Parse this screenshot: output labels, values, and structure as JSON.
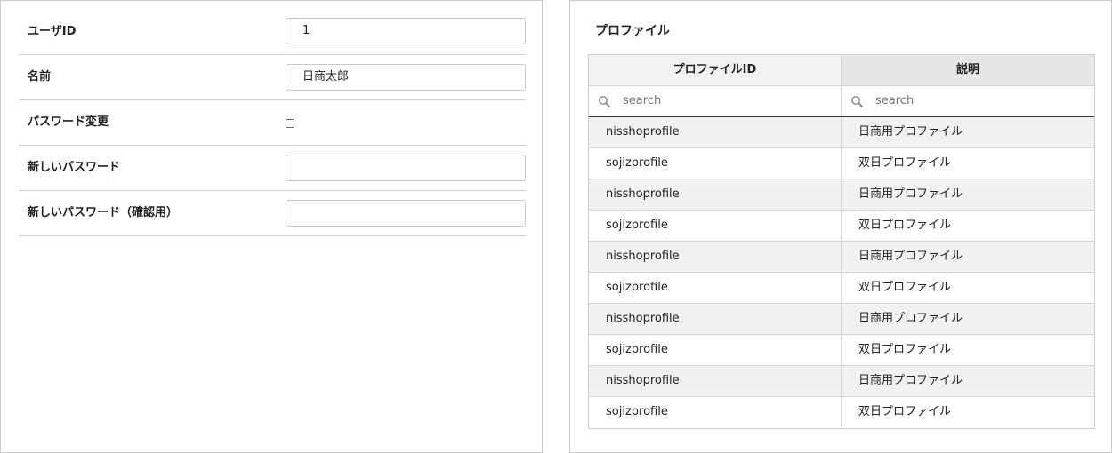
{
  "form": {
    "fields": [
      {
        "label": "ユーザID",
        "value": "1"
      },
      {
        "label": "名前",
        "value": "日商太郎"
      },
      {
        "label": "パスワード変更",
        "checked": false
      },
      {
        "label": "新しいパスワード",
        "value": ""
      },
      {
        "label": "新しいパスワード（確認用）",
        "value": ""
      }
    ]
  },
  "profiles": {
    "title": "プロファイル",
    "columns": [
      "プロファイルID",
      "説明"
    ],
    "filter_placeholders": [
      "search",
      "search"
    ],
    "rows": [
      [
        "nisshoprofile",
        "日商用プロファイル"
      ],
      [
        "sojizprofile",
        "双日プロファイル"
      ],
      [
        "nisshoprofile",
        "日商用プロファイル"
      ],
      [
        "sojizprofile",
        "双日プロファイル"
      ],
      [
        "nisshoprofile",
        "日商用プロファイル"
      ],
      [
        "sojizprofile",
        "双日プロファイル"
      ],
      [
        "nisshoprofile",
        "日商用プロファイル"
      ],
      [
        "sojizprofile",
        "双日プロファイル"
      ],
      [
        "nisshoprofile",
        "日商用プロファイル"
      ],
      [
        "sojizprofile",
        "双日プロファイル"
      ]
    ]
  }
}
